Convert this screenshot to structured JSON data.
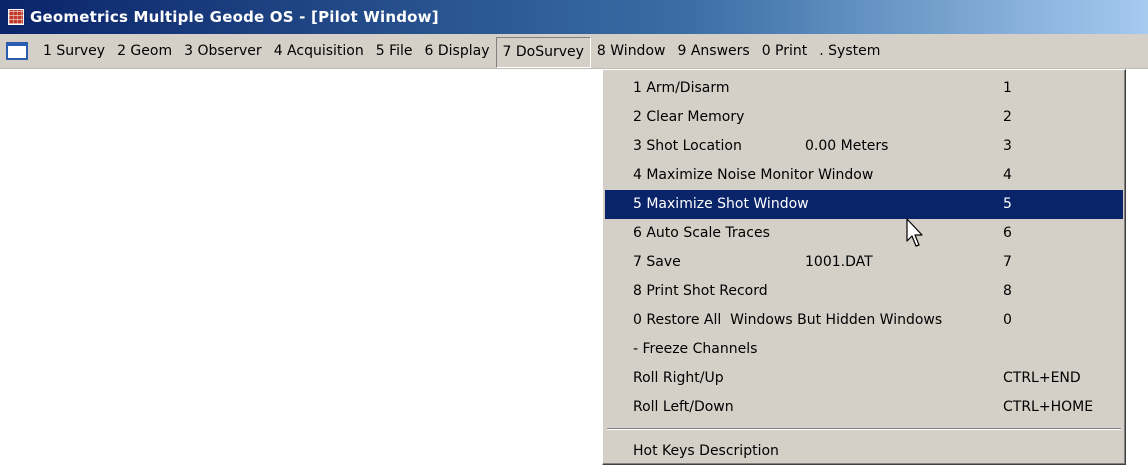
{
  "window": {
    "title": "Geometrics Multiple Geode OS - [Pilot Window]"
  },
  "menubar": {
    "items": [
      {
        "label": "1 Survey"
      },
      {
        "label": "2 Geom"
      },
      {
        "label": "3 Observer"
      },
      {
        "label": "4 Acquisition"
      },
      {
        "label": "5 File"
      },
      {
        "label": "6 Display"
      },
      {
        "label": "7 DoSurvey",
        "active": true
      },
      {
        "label": "8 Window"
      },
      {
        "label": "9 Answers"
      },
      {
        "label": "0 Print"
      },
      {
        "label": ". System"
      }
    ]
  },
  "dosurvey_menu": {
    "items": [
      {
        "label": "1 Arm/Disarm",
        "value": "",
        "shortcut": "1"
      },
      {
        "label": "2 Clear Memory",
        "value": "",
        "shortcut": "2"
      },
      {
        "label": "3 Shot Location",
        "value": "0.00 Meters",
        "shortcut": "3"
      },
      {
        "label": "4 Maximize Noise Monitor Window",
        "value": "",
        "shortcut": "4"
      },
      {
        "label": "5 Maximize Shot Window",
        "value": "",
        "shortcut": "5",
        "highlighted": true
      },
      {
        "label": "6 Auto Scale Traces",
        "value": "",
        "shortcut": "6"
      },
      {
        "label": "7 Save",
        "value": "1001.DAT",
        "shortcut": "7"
      },
      {
        "label": "8 Print Shot Record",
        "value": "",
        "shortcut": "8"
      },
      {
        "label": "0 Restore All  Windows But Hidden Windows",
        "value": "",
        "shortcut": "0"
      },
      {
        "label": "- Freeze Channels",
        "value": "",
        "shortcut": ""
      },
      {
        "label": "Roll Right/Up",
        "value": "",
        "shortcut": "CTRL+END"
      },
      {
        "label": "Roll Left/Down",
        "value": "",
        "shortcut": "CTRL+HOME"
      }
    ],
    "footer_item": {
      "label": "Hot Keys Description"
    }
  },
  "colors": {
    "title_gradient_start": "#0a246a",
    "title_gradient_end": "#a6caf0",
    "menu_face": "#d4d0c8",
    "highlight": "#0a246a"
  }
}
